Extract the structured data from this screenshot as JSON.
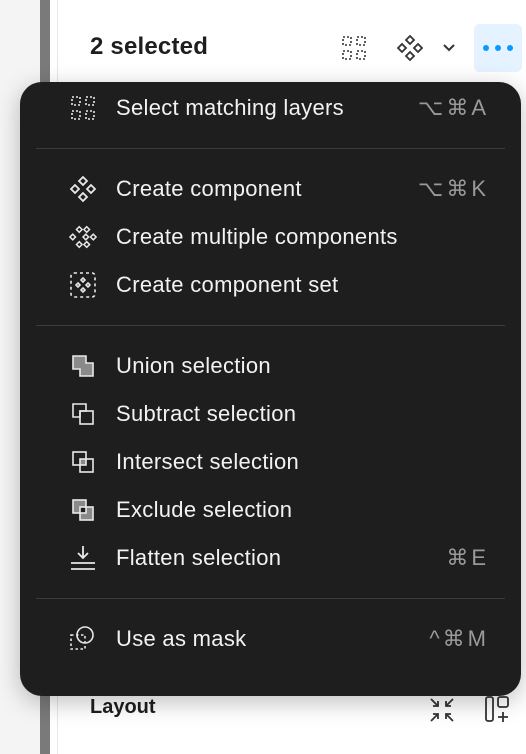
{
  "header": {
    "title": "2 selected",
    "icons": [
      "select-matching-icon",
      "component-icon",
      "chevron-down-icon",
      "more-icon"
    ]
  },
  "menu": {
    "sections": [
      {
        "items": [
          {
            "label": "Select matching layers",
            "shortcut": "⌥⌘A",
            "icon": "select-matching-icon"
          }
        ]
      },
      {
        "items": [
          {
            "label": "Create component",
            "shortcut": "⌥⌘K",
            "icon": "component-icon"
          },
          {
            "label": "Create multiple components",
            "shortcut": "",
            "icon": "multiple-components-icon"
          },
          {
            "label": "Create component set",
            "shortcut": "",
            "icon": "component-set-icon"
          }
        ]
      },
      {
        "items": [
          {
            "label": "Union selection",
            "shortcut": "",
            "icon": "union-icon"
          },
          {
            "label": "Subtract selection",
            "shortcut": "",
            "icon": "subtract-icon"
          },
          {
            "label": "Intersect selection",
            "shortcut": "",
            "icon": "intersect-icon"
          },
          {
            "label": "Exclude selection",
            "shortcut": "",
            "icon": "exclude-icon"
          },
          {
            "label": "Flatten selection",
            "shortcut": "⌘E",
            "icon": "flatten-icon"
          }
        ]
      },
      {
        "items": [
          {
            "label": "Use as mask",
            "shortcut": "^⌘M",
            "icon": "mask-icon"
          }
        ]
      }
    ]
  },
  "footer": {
    "label": "Layout",
    "icons": [
      "resize-to-fit-icon",
      "auto-layout-icon"
    ]
  },
  "colors": {
    "menu_bg": "#1e1e1e",
    "menu_text": "#f2f2f2",
    "shortcut_text": "#9a9a9a",
    "accent": "#0d99ff",
    "accent_bg": "#e5f2ff"
  }
}
